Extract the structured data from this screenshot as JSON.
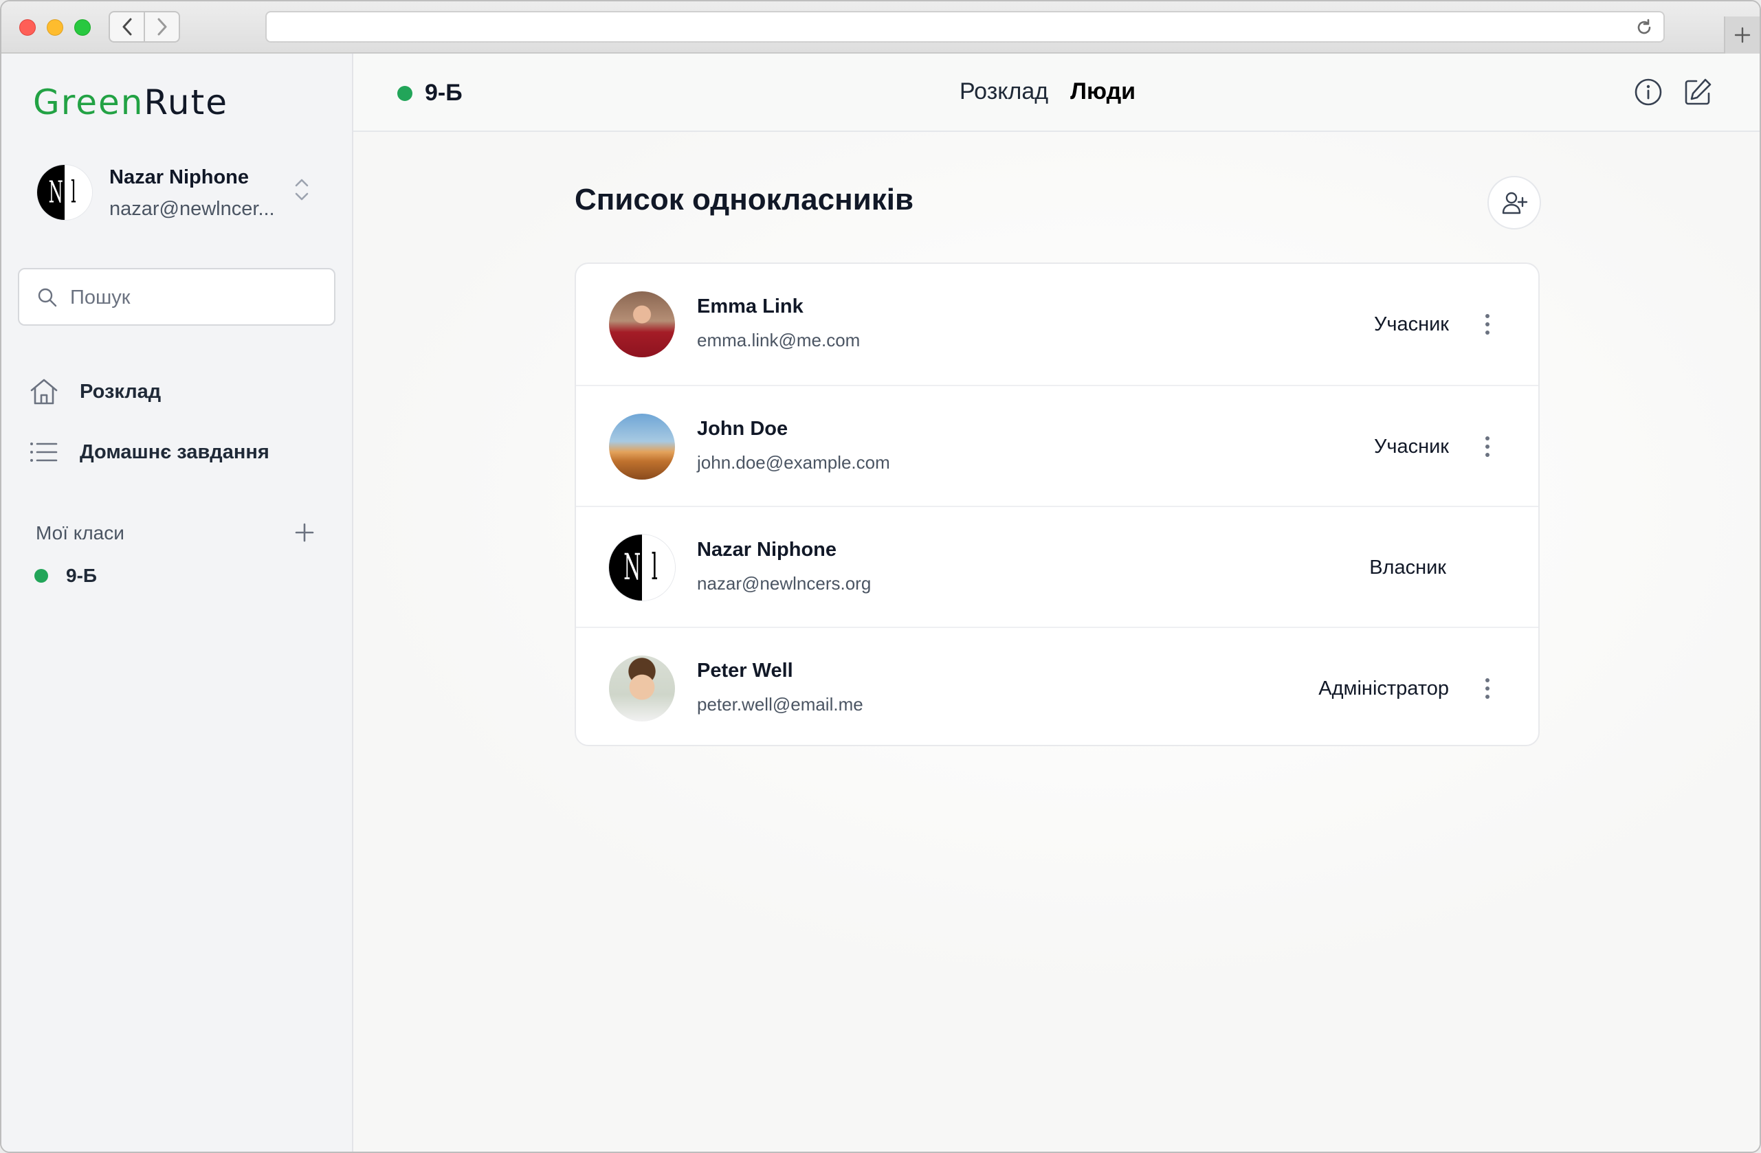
{
  "app": {
    "logo_green": "Green",
    "logo_dark": "Rute",
    "user_initials": [
      "N",
      "l"
    ]
  },
  "user": {
    "name": "Nazar Niphone",
    "email": "nazar@newlncer..."
  },
  "search": {
    "placeholder": "Пошук"
  },
  "sidebar": {
    "items": [
      {
        "label": "Розклад",
        "icon": "home-icon"
      },
      {
        "label": "Домашнє завдання",
        "icon": "list-icon"
      }
    ],
    "section_title": "Мої класи",
    "classes": [
      {
        "label": "9-Б",
        "color": "#22a559"
      }
    ]
  },
  "header": {
    "class_name": "9-Б",
    "tabs": [
      {
        "label": "Розклад",
        "active": false
      },
      {
        "label": "Люди",
        "active": true
      }
    ]
  },
  "main": {
    "title": "Список однокласників",
    "people": [
      {
        "name": "Emma Link",
        "email": "emma.link@me.com",
        "role": "Учасник",
        "has_menu": true
      },
      {
        "name": "John Doe",
        "email": "john.doe@example.com",
        "role": "Учасник",
        "has_menu": true
      },
      {
        "name": "Nazar Niphone",
        "email": "nazar@newlncers.org",
        "role": "Власник",
        "has_menu": false
      },
      {
        "name": "Peter Well",
        "email": "peter.well@email.me",
        "role": "Адміністратор",
        "has_menu": true
      }
    ]
  },
  "colors": {
    "brand_green": "#22a244",
    "status_green": "#22a559"
  }
}
